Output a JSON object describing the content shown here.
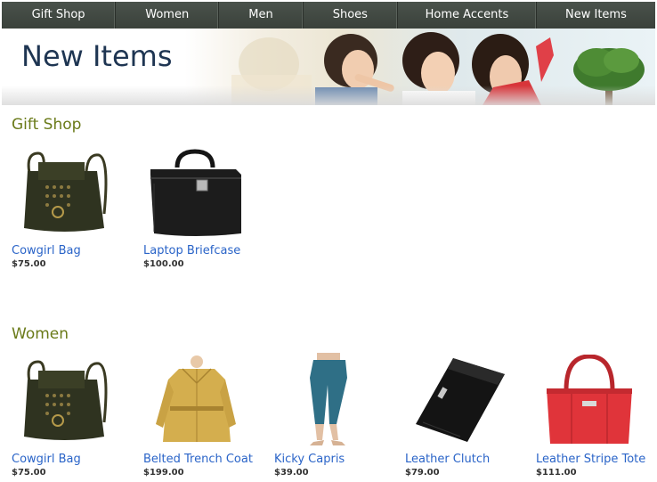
{
  "nav": {
    "items": [
      "Gift Shop",
      "Women",
      "Men",
      "Shoes",
      "Home Accents",
      "New Items"
    ]
  },
  "banner": {
    "title": "New Items"
  },
  "sections": [
    {
      "title": "Gift Shop",
      "products": [
        {
          "name": "Cowgirl Bag",
          "price": "$75.00",
          "icon": "cowgirl-bag-icon"
        },
        {
          "name": "Laptop Briefcase",
          "price": "$100.00",
          "icon": "briefcase-icon"
        }
      ]
    },
    {
      "title": "Women",
      "products": [
        {
          "name": "Cowgirl Bag",
          "price": "$75.00",
          "icon": "cowgirl-bag-icon"
        },
        {
          "name": "Belted Trench Coat",
          "price": "$199.00",
          "icon": "trench-coat-icon"
        },
        {
          "name": "Kicky Capris",
          "price": "$39.00",
          "icon": "capris-icon"
        },
        {
          "name": "Leather Clutch",
          "price": "$79.00",
          "icon": "clutch-icon"
        },
        {
          "name": "Leather Stripe Tote",
          "price": "$111.00",
          "icon": "tote-icon"
        }
      ]
    }
  ],
  "colors": {
    "nav_bg": "#3f463f",
    "banner_title": "#1e3552",
    "section_title": "#6a7a18",
    "link": "#2a64c8",
    "price": "#333333"
  }
}
